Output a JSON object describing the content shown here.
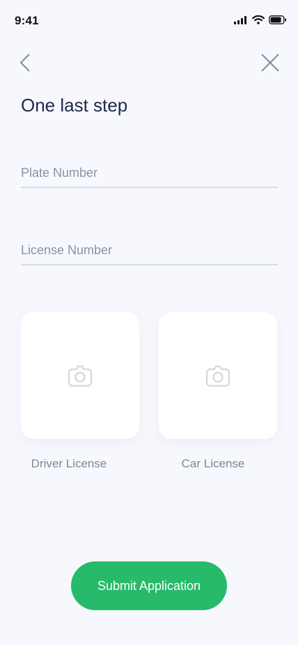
{
  "status_bar": {
    "time": "9:41",
    "icons": [
      "signal-icon",
      "wifi-icon",
      "battery-icon"
    ]
  },
  "nav": {
    "back_icon": "chevron-left-icon",
    "close_icon": "close-icon"
  },
  "page": {
    "title": "One last step"
  },
  "form": {
    "plate_placeholder": "Plate Number",
    "plate_value": "",
    "license_placeholder": "License Number",
    "license_value": ""
  },
  "uploads": [
    {
      "label": "Driver License",
      "icon": "camera-icon"
    },
    {
      "label": "Car License",
      "icon": "camera-icon"
    }
  ],
  "actions": {
    "submit_label": "Submit Application"
  },
  "colors": {
    "background": "#F7F8FD",
    "title": "#1E2A4A",
    "accent": "#26BA6A",
    "muted_text": "#7E8696",
    "divider": "#D7DAE1",
    "icon": "#D8D9DD"
  }
}
